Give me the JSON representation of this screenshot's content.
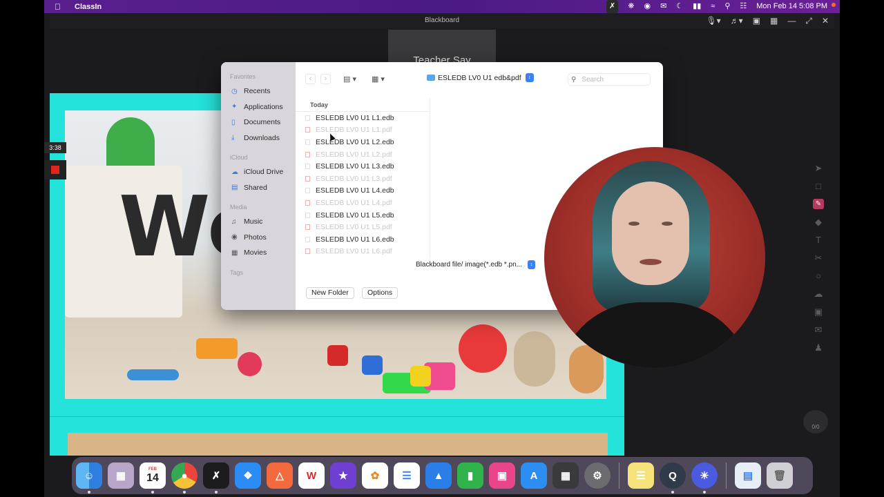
{
  "menubar": {
    "app_name": "ClassIn",
    "datetime": "Mon Feb 14  5:08 PM"
  },
  "window": {
    "title": "Blackboard",
    "teacher_say": "Teacher Say",
    "timer": "3:38",
    "counter": "0/0"
  },
  "stage": {
    "big_text": "Wo"
  },
  "dialog": {
    "sidebar": {
      "favorites_heading": "Favorites",
      "favorites": [
        "Recents",
        "Applications",
        "Documents",
        "Downloads"
      ],
      "icloud_heading": "iCloud",
      "icloud": [
        "iCloud Drive",
        "Shared"
      ],
      "media_heading": "Media",
      "media": [
        "Music",
        "Photos",
        "Movies"
      ],
      "tags_heading": "Tags"
    },
    "path_label": "ESLEDB LV0 U1 edb&pdf",
    "search_placeholder": "Search",
    "list_heading": "Today",
    "files": [
      {
        "name": "ESLEDB LV0 U1 L1.edb",
        "enabled": true
      },
      {
        "name": "ESLEDB LV0 U1 L1.pdf",
        "enabled": false
      },
      {
        "name": "ESLEDB LV0 U1 L2.edb",
        "enabled": true
      },
      {
        "name": "ESLEDB LV0 U1 L2.pdf",
        "enabled": false
      },
      {
        "name": "ESLEDB LV0 U1 L3.edb",
        "enabled": true
      },
      {
        "name": "ESLEDB LV0 U1 L3.pdf",
        "enabled": false
      },
      {
        "name": "ESLEDB LV0 U1 L4.edb",
        "enabled": true
      },
      {
        "name": "ESLEDB LV0 U1 L4.pdf",
        "enabled": false
      },
      {
        "name": "ESLEDB LV0 U1 L5.edb",
        "enabled": true
      },
      {
        "name": "ESLEDB LV0 U1 L5.pdf",
        "enabled": false
      },
      {
        "name": "ESLEDB LV0 U1 L6.edb",
        "enabled": true
      },
      {
        "name": "ESLEDB LV0 U1 L6.pdf",
        "enabled": false
      }
    ],
    "format_label": "Blackboard file/ image(*.edb *.pn...",
    "new_folder_label": "New Folder",
    "options_label": "Options"
  },
  "dock": {
    "calendar_month": "FEB",
    "calendar_day": "14",
    "apps": [
      "finder-icon",
      "launchpad-icon",
      "calendar-icon",
      "chrome-icon",
      "classin-icon",
      "bear-icon",
      "origin-icon",
      "wps-icon",
      "imovie-icon",
      "photos-icon",
      "reminders-icon",
      "keynote-icon",
      "numbers-icon",
      "screens-icon",
      "app-store-icon",
      "calculator-icon",
      "system-preferences-icon",
      "notes-icon",
      "quicktime-icon",
      "sun-icon",
      "preview-icon",
      "trash-icon"
    ]
  },
  "colors": {
    "stage_bg": "#24e3da",
    "accent": "#3b82f0",
    "record": "#e2261d"
  }
}
